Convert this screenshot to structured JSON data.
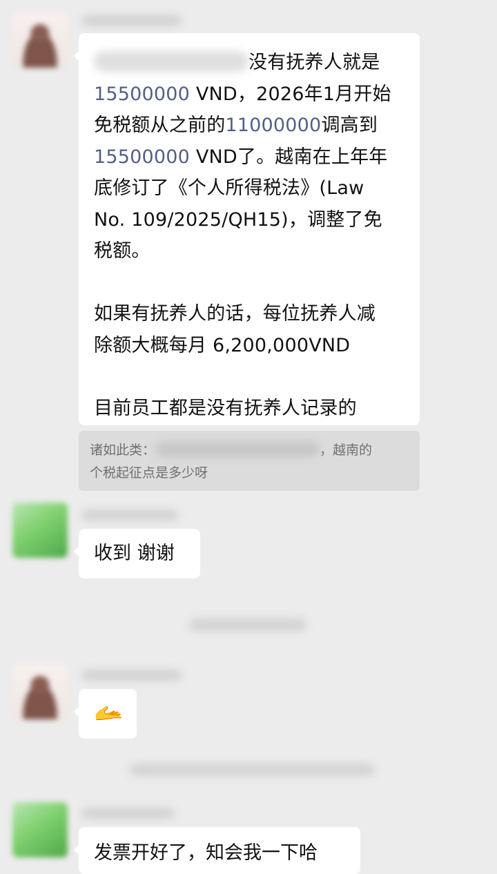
{
  "messages": [
    {
      "lines": [
        {
          "t1": "没有抚养人就是"
        },
        {
          "n1": "15500000",
          "t1": " VND，2026年1月开始"
        },
        {
          "t1": "免税额从之前的",
          "n1": "11000000",
          "t2": "调高到"
        },
        {
          "n1": "15500000",
          "t1": " VND了。越南在上年年"
        },
        {
          "t1": "底修订了《个人所得税法》(Law"
        },
        {
          "t1": "No. 109/2025/QH15)，调整了免"
        },
        {
          "t1": "税额。"
        },
        {
          "t1": ""
        },
        {
          "t1": "如果有抚养人的话，每位抚养人减"
        },
        {
          "t1": "除额大概每月 6,200,000VND"
        },
        {
          "t1": ""
        },
        {
          "t1": "目前员工都是没有抚养人记录的"
        }
      ]
    },
    {
      "text": "收到 谢谢"
    },
    {
      "emoji": "🫴"
    },
    {
      "text": "发票开好了，知会我一下哈"
    }
  ],
  "quote": {
    "prefix": "诸如此类：",
    "suffix": "，越南的",
    "line2": "个税起征点是多少呀"
  }
}
